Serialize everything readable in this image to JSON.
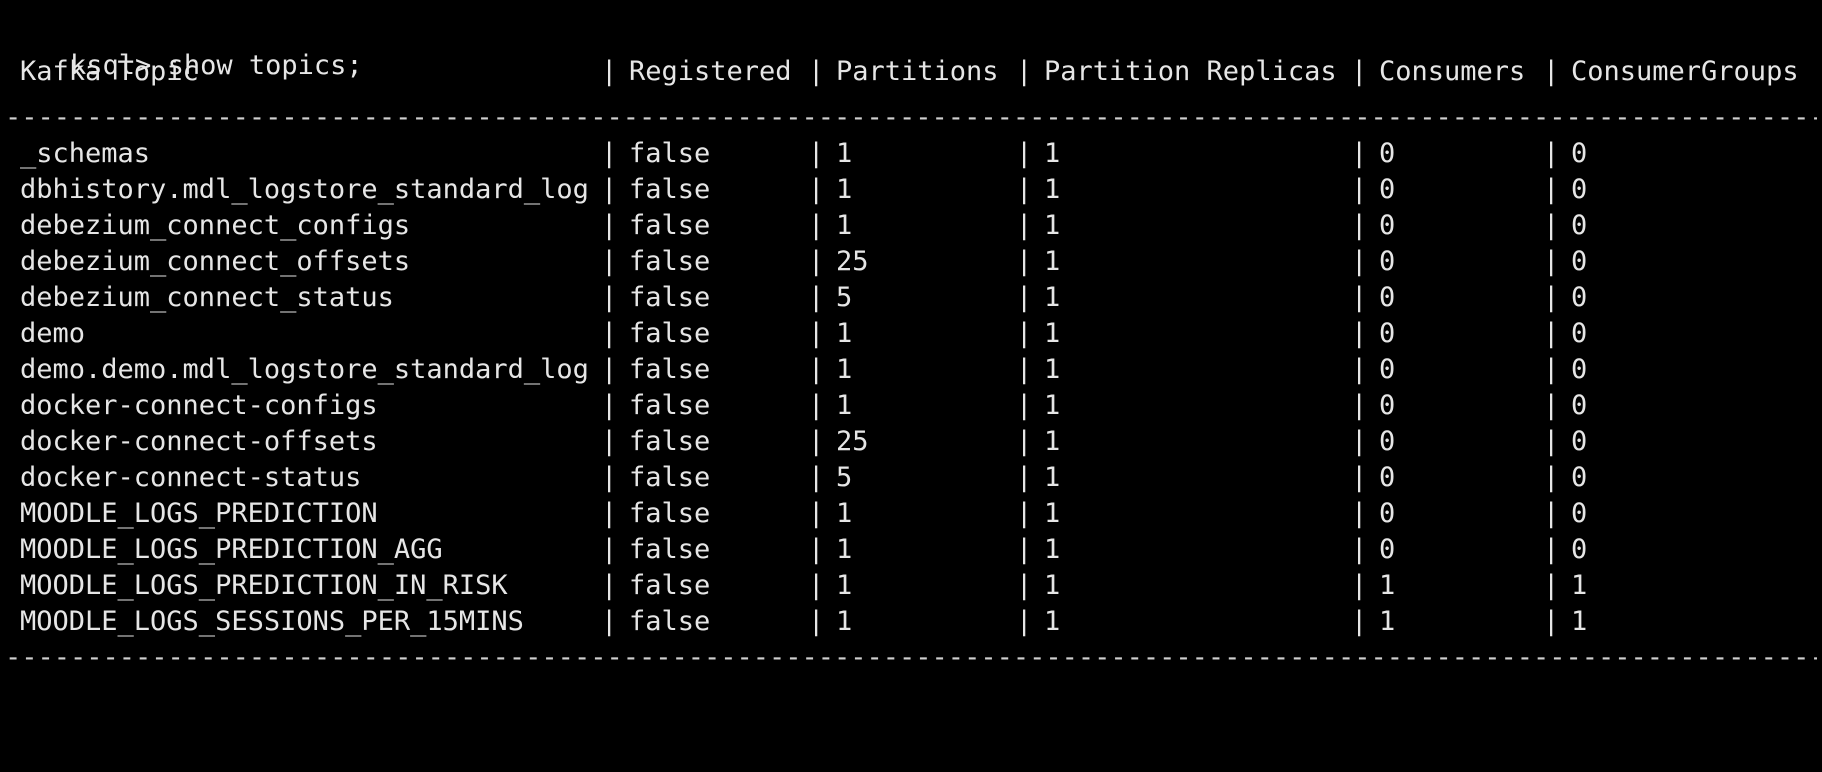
{
  "terminal": {
    "prompt": "ksql>",
    "command": "show topics;",
    "separator": "----------------------------------------------------------------------------------------------------------------------------------------------------------------------------------------------------"
  },
  "table": {
    "pipe": "|",
    "headers": [
      "Kafka Topic",
      "Registered",
      "Partitions",
      "Partition Replicas",
      "Consumers",
      "ConsumerGroups"
    ],
    "rows": [
      [
        "_schemas",
        "false",
        "1",
        "1",
        "0",
        "0"
      ],
      [
        "dbhistory.mdl_logstore_standard_log",
        "false",
        "1",
        "1",
        "0",
        "0"
      ],
      [
        "debezium_connect_configs",
        "false",
        "1",
        "1",
        "0",
        "0"
      ],
      [
        "debezium_connect_offsets",
        "false",
        "25",
        "1",
        "0",
        "0"
      ],
      [
        "debezium_connect_status",
        "false",
        "5",
        "1",
        "0",
        "0"
      ],
      [
        "demo",
        "false",
        "1",
        "1",
        "0",
        "0"
      ],
      [
        "demo.demo.mdl_logstore_standard_log",
        "false",
        "1",
        "1",
        "0",
        "0"
      ],
      [
        "docker-connect-configs",
        "false",
        "1",
        "1",
        "0",
        "0"
      ],
      [
        "docker-connect-offsets",
        "false",
        "25",
        "1",
        "0",
        "0"
      ],
      [
        "docker-connect-status",
        "false",
        "5",
        "1",
        "0",
        "0"
      ],
      [
        "MOODLE_LOGS_PREDICTION",
        "false",
        "1",
        "1",
        "0",
        "0"
      ],
      [
        "MOODLE_LOGS_PREDICTION_AGG",
        "false",
        "1",
        "1",
        "0",
        "0"
      ],
      [
        "MOODLE_LOGS_PREDICTION_IN_RISK",
        "false",
        "1",
        "1",
        "1",
        "1"
      ],
      [
        "MOODLE_LOGS_SESSIONS_PER_15MINS",
        "false",
        "1",
        "1",
        "1",
        "1"
      ]
    ]
  }
}
